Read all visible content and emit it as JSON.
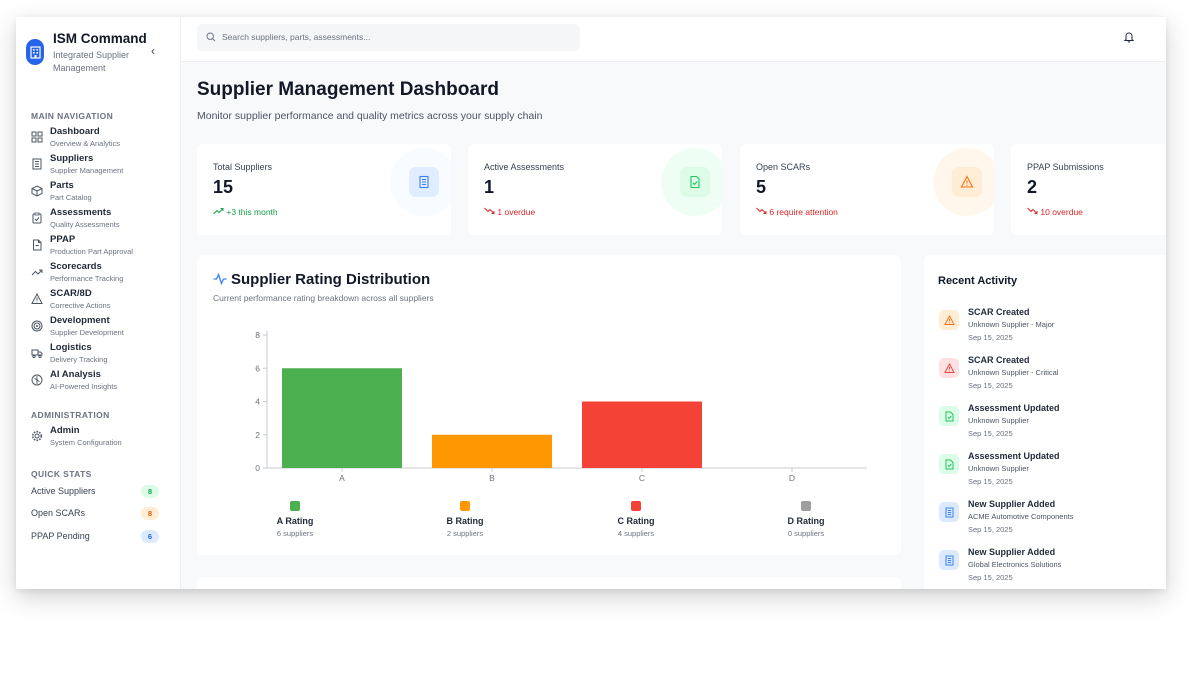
{
  "brand": {
    "title": "ISM Command",
    "subtitle": "Integrated Supplier Management",
    "collapse_icon": "chevron-left-icon"
  },
  "sidebar": {
    "main_nav_label": "MAIN NAVIGATION",
    "items": [
      {
        "label": "Dashboard",
        "sub": "Overview & Analytics",
        "icon": "grid-icon"
      },
      {
        "label": "Suppliers",
        "sub": "Supplier Management",
        "icon": "building-icon"
      },
      {
        "label": "Parts",
        "sub": "Part Catalog",
        "icon": "box-icon"
      },
      {
        "label": "Assessments",
        "sub": "Quality Assessments",
        "icon": "clipboard-icon"
      },
      {
        "label": "PPAP",
        "sub": "Production Part Approval",
        "icon": "file-icon"
      },
      {
        "label": "Scorecards",
        "sub": "Performance Tracking",
        "icon": "trend-icon"
      },
      {
        "label": "SCAR/8D",
        "sub": "Corrective Actions",
        "icon": "warning-icon"
      },
      {
        "label": "Development",
        "sub": "Supplier Development",
        "icon": "target-icon"
      },
      {
        "label": "Logistics",
        "sub": "Delivery Tracking",
        "icon": "truck-icon"
      },
      {
        "label": "AI Analysis",
        "sub": "AI-Powered Insights",
        "icon": "brain-icon"
      }
    ],
    "admin_label": "ADMINISTRATION",
    "admin_items": [
      {
        "label": "Admin",
        "sub": "System Configuration",
        "icon": "gear-icon"
      }
    ],
    "quick_stats_label": "QUICK STATS",
    "quick_stats": [
      {
        "label": "Active Suppliers",
        "value": "8",
        "color": "#16a34a",
        "bg": "#dcfce7"
      },
      {
        "label": "Open SCARs",
        "value": "8",
        "color": "#ea580c",
        "bg": "#ffedd5"
      },
      {
        "label": "PPAP Pending",
        "value": "6",
        "color": "#2563eb",
        "bg": "#dbeafe"
      }
    ]
  },
  "search": {
    "placeholder": "Search suppliers, parts, assessments..."
  },
  "header": {
    "title": "Supplier Management Dashboard",
    "subtitle": "Monitor supplier performance and quality metrics across your supply chain"
  },
  "stats": [
    {
      "label": "Total Suppliers",
      "value": "15",
      "trend": "+3 this month",
      "trend_color": "#16a34a",
      "trend_icon": "trend-up-icon",
      "icon": "building-icon",
      "accent": "#3b82f6",
      "bg": "#eff6ff"
    },
    {
      "label": "Active Assessments",
      "value": "1",
      "trend": "1 overdue",
      "trend_color": "#dc2626",
      "trend_icon": "trend-down-icon",
      "icon": "file-check-icon",
      "accent": "#22c55e",
      "bg": "#f0fdf4"
    },
    {
      "label": "Open SCARs",
      "value": "5",
      "trend": "6 require attention",
      "trend_color": "#dc2626",
      "trend_icon": "trend-down-icon",
      "icon": "warning-icon",
      "accent": "#f97316",
      "bg": "#fff7ed"
    },
    {
      "label": "PPAP Submissions",
      "value": "2",
      "trend": "10 overdue",
      "trend_color": "#dc2626",
      "trend_icon": "trend-down-icon",
      "icon": "file-icon",
      "accent": "#8b5cf6",
      "bg": "#f5f3ff"
    }
  ],
  "chart": {
    "title": "Supplier Rating Distribution",
    "subtitle": "Current performance rating breakdown across all suppliers",
    "icon": "activity-icon",
    "legend": [
      {
        "name": "A Rating",
        "count": "6 suppliers"
      },
      {
        "name": "B Rating",
        "count": "2 suppliers"
      },
      {
        "name": "C Rating",
        "count": "4 suppliers"
      },
      {
        "name": "D Rating",
        "count": "0 suppliers"
      }
    ]
  },
  "chart_data": {
    "type": "bar",
    "categories": [
      "A",
      "B",
      "C",
      "D"
    ],
    "values": [
      6,
      2,
      4,
      0
    ],
    "colors": [
      "#4caf50",
      "#ff9800",
      "#f44336",
      "#9e9e9e"
    ],
    "yticks": [
      0,
      2,
      4,
      6,
      8
    ],
    "ylim": [
      0,
      8
    ],
    "grid": false
  },
  "activity": {
    "title": "Recent Activity",
    "items": [
      {
        "title": "SCAR Created",
        "desc": "Unknown Supplier - Major",
        "date": "Sep 15, 2025",
        "icon": "warning-icon",
        "color": "#f97316",
        "bg": "#ffedd5"
      },
      {
        "title": "SCAR Created",
        "desc": "Unknown Supplier - Critical",
        "date": "Sep 15, 2025",
        "icon": "warning-icon",
        "color": "#ef4444",
        "bg": "#fee2e2"
      },
      {
        "title": "Assessment Updated",
        "desc": "Unknown Supplier",
        "date": "Sep 15, 2025",
        "icon": "file-check-icon",
        "color": "#22c55e",
        "bg": "#dcfce7"
      },
      {
        "title": "Assessment Updated",
        "desc": "Unknown Supplier",
        "date": "Sep 15, 2025",
        "icon": "file-check-icon",
        "color": "#22c55e",
        "bg": "#dcfce7"
      },
      {
        "title": "New Supplier Added",
        "desc": "ACME Automotive Components",
        "date": "Sep 15, 2025",
        "icon": "building-icon",
        "color": "#3b82f6",
        "bg": "#dbeafe"
      },
      {
        "title": "New Supplier Added",
        "desc": "Global Electronics Solutions",
        "date": "Sep 15, 2025",
        "icon": "building-icon",
        "color": "#3b82f6",
        "bg": "#dbeafe"
      }
    ]
  }
}
